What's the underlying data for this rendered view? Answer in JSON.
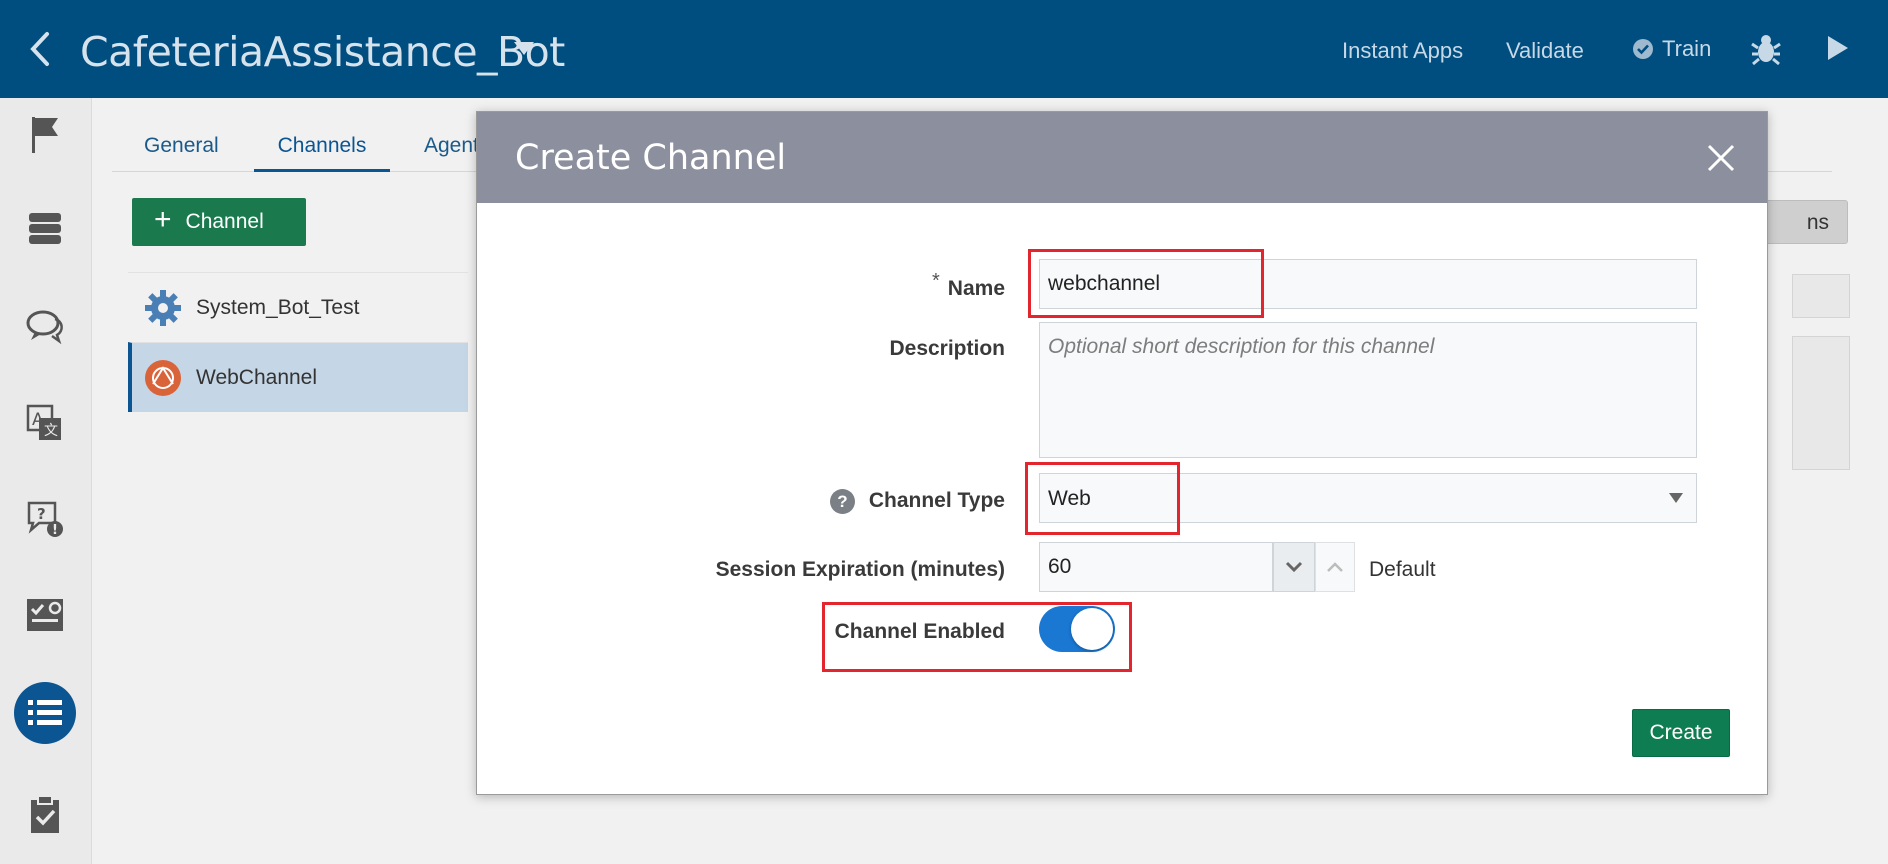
{
  "header": {
    "title": "CafeteriaAssistance_Bot",
    "instant_apps": "Instant Apps",
    "validate": "Validate",
    "train": "Train"
  },
  "rail": {
    "icons": [
      "flag-icon",
      "database-icon",
      "chat-bubbles-icon",
      "translate-icon",
      "qna-icon",
      "skill-checklist-icon",
      "list-icon",
      "clipboard-check-icon"
    ],
    "active": "list-icon"
  },
  "main": {
    "tabs": [
      {
        "label": "General"
      },
      {
        "label": "Channels",
        "active": true
      },
      {
        "label": "Agent In"
      }
    ],
    "add_channel_label": "Channel",
    "channels": [
      {
        "name": "System_Bot_Test",
        "icon": "gear-icon"
      },
      {
        "name": "WebChannel",
        "icon": "web-channel-icon",
        "selected": true
      }
    ],
    "right_button_partial": "ns"
  },
  "modal": {
    "title": "Create Channel",
    "name_label": "Name",
    "required_mark": "*",
    "name_value": "webchannel",
    "description_label": "Description",
    "description_placeholder": "Optional short description for this channel",
    "channel_type_label": "Channel Type",
    "channel_type_value": "Web",
    "session_label": "Session Expiration (minutes)",
    "session_value": "60",
    "session_default": "Default",
    "enabled_label": "Channel Enabled",
    "enabled": true,
    "create_label": "Create"
  },
  "colors": {
    "topbar": "#004d7f",
    "primary_green": "#0e7d52",
    "toggle_on": "#1a77d2",
    "highlight": "#e3252d",
    "modal_header": "#8c8f9d"
  }
}
